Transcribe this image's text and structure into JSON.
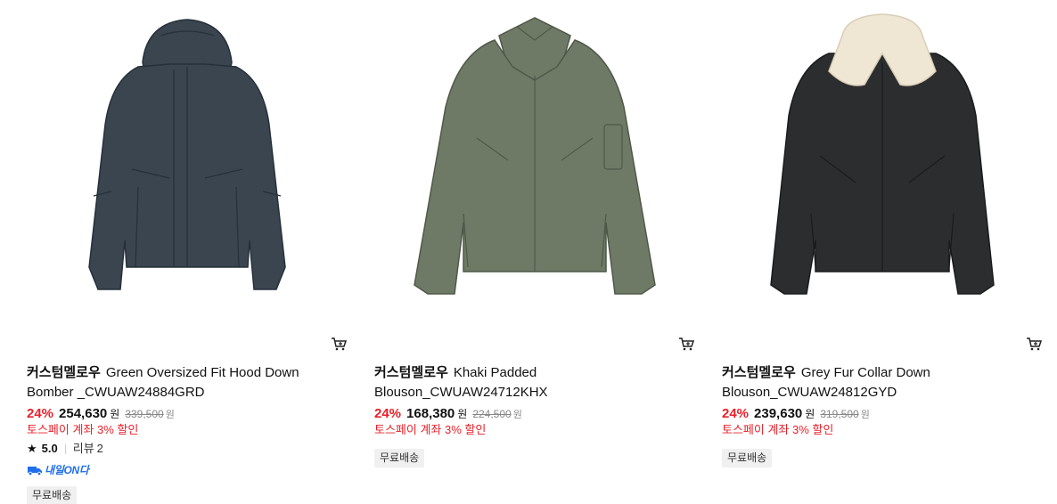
{
  "products": [
    {
      "brand": "커스텀멜로우",
      "name": "Green Oversized Fit Hood Down Bomber _CWUAW24884GRD",
      "discount": "24%",
      "price": "254,630",
      "currency": "원",
      "original_price": "339,500",
      "original_currency": "원",
      "promo": "토스페이 계좌 3% 할인",
      "rating": "5.0",
      "review_label": "리뷰",
      "review_count": "2",
      "delivery_badge": "내일ON다",
      "shipping": "무료배송",
      "image_color": "#3a4550",
      "image_icon": "hooded-down-jacket"
    },
    {
      "brand": "커스텀멜로우",
      "name": "Khaki Padded Blouson_CWUAW24712KHX",
      "discount": "24%",
      "price": "168,380",
      "currency": "원",
      "original_price": "224,500",
      "original_currency": "원",
      "promo": "토스페이 계좌 3% 할인",
      "shipping": "무료배송",
      "image_color": "#6f7a66",
      "image_icon": "padded-blouson"
    },
    {
      "brand": "커스텀멜로우",
      "name": "Grey Fur Collar Down Blouson_CWUAW24812GYD",
      "discount": "24%",
      "price": "239,630",
      "currency": "원",
      "original_price": "319,500",
      "original_currency": "원",
      "promo": "토스페이 계좌 3% 할인",
      "shipping": "무료배송",
      "image_color": "#2c2d2f",
      "image_icon": "fur-collar-blouson"
    }
  ],
  "colors": {
    "discount": "#e8202a",
    "delivery": "#1f6feb",
    "badge_bg": "#f0f0f0"
  }
}
